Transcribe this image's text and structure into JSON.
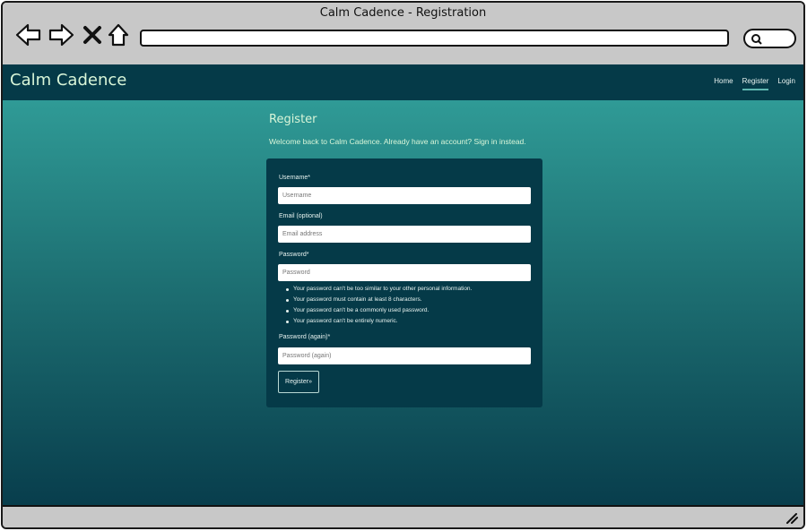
{
  "window": {
    "title": "Calm Cadence - Registration"
  },
  "site": {
    "brand": "Calm Cadence",
    "nav": [
      {
        "label": "Home",
        "active": false
      },
      {
        "label": "Register",
        "active": true
      },
      {
        "label": "Login",
        "active": false
      }
    ]
  },
  "page": {
    "title": "Register",
    "welcome": "Welcome back to Calm Cadence. Already have an account? Sign in instead."
  },
  "form": {
    "username_label": "Username*",
    "username_placeholder": "Username",
    "email_label": "Email (optional)",
    "email_placeholder": "Email address",
    "password_label": "Password*",
    "password_placeholder": "Password",
    "password_help": [
      "Your password can't be too similar to your other personal information.",
      "Your password must contain at least 8 characters.",
      "Your password can't be a commonly used password.",
      "Your password can't be entirely numeric."
    ],
    "password2_label": "Password (again)*",
    "password2_placeholder": "Password (again)",
    "submit_label": "Register»"
  },
  "colors": {
    "navbar": "#053a48",
    "card": "#053a48",
    "gradient_top": "#33a39d",
    "gradient_bottom": "#083d4c",
    "accent_text": "#d8f5d8"
  },
  "icons": [
    "back-arrow-icon",
    "forward-arrow-icon",
    "close-icon",
    "home-icon",
    "search-icon",
    "resize-grip-icon"
  ]
}
